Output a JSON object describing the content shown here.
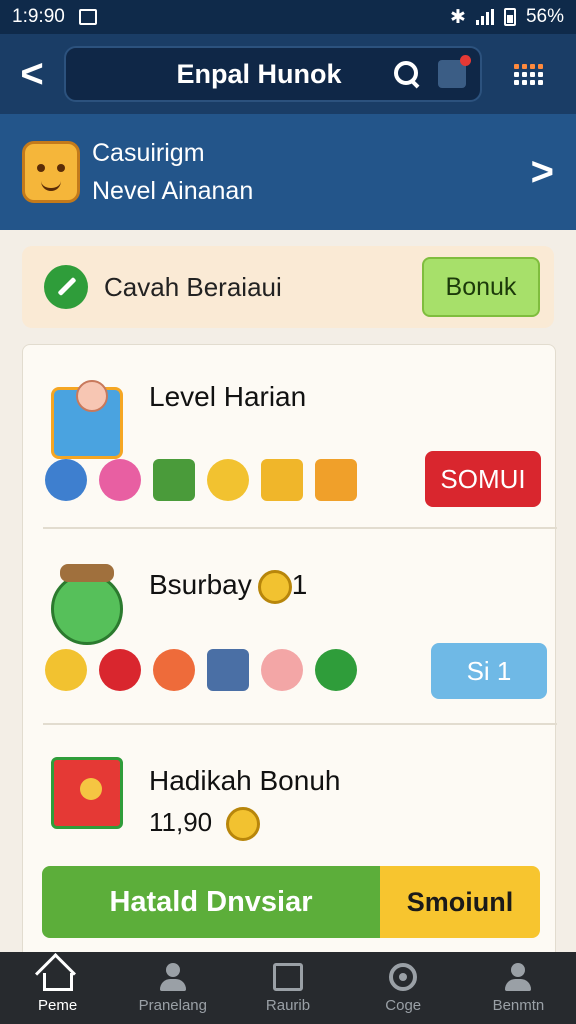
{
  "status_bar": {
    "time": "1:9:90",
    "battery": "56%"
  },
  "header": {
    "title": "Enpal Hunok"
  },
  "banner": {
    "line1": "Casuirigm",
    "line2": "Nevel Ainanan"
  },
  "notice": {
    "text": "Cavah Beraiaui",
    "button": "Bonuk"
  },
  "entries": [
    {
      "title": "Level Harian",
      "button": "SOMUI",
      "button_color": "#d9262e",
      "chips": [
        "#3e7fcf",
        "#e85fa2",
        "#4a9b3a",
        "#f2c230",
        "#f0b62a",
        "#f0a02a"
      ]
    },
    {
      "title": "Bsurbay",
      "title_suffix": "1",
      "button": "Si 1",
      "button_color": "#6fb9e6",
      "chips": [
        "#f2c230",
        "#d9262e",
        "#ee6b3a",
        "#4a6fa5",
        "#f3a6a6",
        "#2f9d3a"
      ]
    },
    {
      "title": "Hadikah Bonuh",
      "subtitle": "11,90"
    }
  ],
  "footer_action": {
    "left": "Hatald Dnvsiar",
    "right": "Smoiunl"
  },
  "bottom_nav": [
    {
      "label": "Peme",
      "icon": "home-icon",
      "active": true
    },
    {
      "label": "Pranelang",
      "icon": "profile-icon"
    },
    {
      "label": "Raurib",
      "icon": "book-icon"
    },
    {
      "label": "Coge",
      "icon": "gear-icon"
    },
    {
      "label": "Benmtn",
      "icon": "account-icon"
    }
  ]
}
